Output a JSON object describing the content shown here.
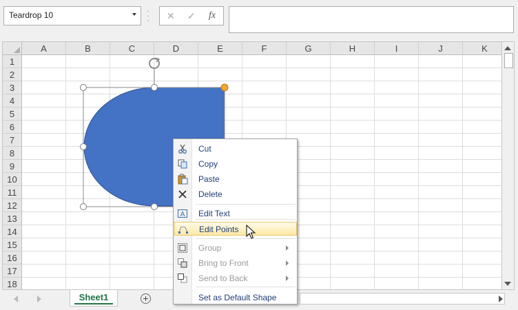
{
  "formula_bar": {
    "name_box_value": "Teardrop 10",
    "cancel_glyph": "✕",
    "enter_glyph": "✓",
    "function_label": "fx",
    "formula_value": ""
  },
  "columns": [
    "A",
    "B",
    "C",
    "D",
    "E",
    "F",
    "G",
    "H",
    "I",
    "J",
    "K"
  ],
  "rows": [
    "1",
    "2",
    "3",
    "4",
    "5",
    "6",
    "7",
    "8",
    "9",
    "10",
    "11",
    "12",
    "13",
    "14",
    "15",
    "16",
    "17",
    "18"
  ],
  "shape": {
    "name": "Teardrop 10",
    "fill_color": "#4472c4",
    "outline_color": "#2f528f",
    "adjust_handle_color": "#f4a533",
    "handle_color": "#ffffff"
  },
  "context_menu": {
    "items": [
      {
        "label": "Cut",
        "icon": "scissors-icon",
        "disabled": false,
        "submenu": false
      },
      {
        "label": "Copy",
        "icon": "copy-icon",
        "disabled": false,
        "submenu": false
      },
      {
        "label": "Paste",
        "icon": "paste-icon",
        "disabled": false,
        "submenu": false
      },
      {
        "label": "Delete",
        "icon": "delete-x-icon",
        "disabled": false,
        "submenu": false
      },
      {
        "label": "Edit Text",
        "icon": "edit-text-icon",
        "disabled": false,
        "submenu": false
      },
      {
        "label": "Edit Points",
        "icon": "edit-points-icon",
        "disabled": false,
        "submenu": false,
        "highlighted": true
      },
      {
        "label": "Group",
        "icon": "group-icon",
        "disabled": true,
        "submenu": true
      },
      {
        "label": "Bring to Front",
        "icon": "bring-to-front-icon",
        "disabled": true,
        "submenu": true
      },
      {
        "label": "Send to Back",
        "icon": "send-to-back-icon",
        "disabled": true,
        "submenu": true
      },
      {
        "label": "Set as Default Shape",
        "icon": "",
        "disabled": false,
        "submenu": false
      }
    ],
    "highlight_color": "#fde8a6"
  },
  "sheets": {
    "active": "Sheet1",
    "active_color": "#217346"
  }
}
